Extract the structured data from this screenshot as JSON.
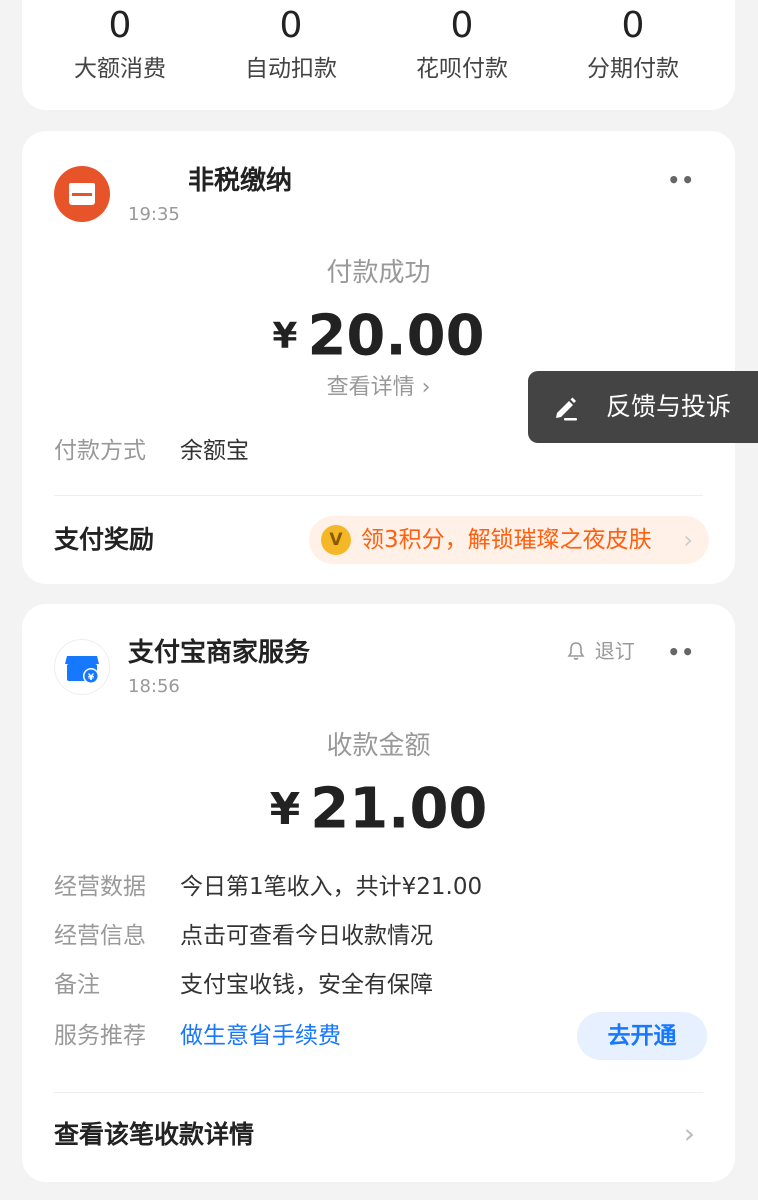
{
  "stats": [
    {
      "value": "0",
      "label": "大额消费"
    },
    {
      "value": "0",
      "label": "自动扣款"
    },
    {
      "value": "0",
      "label": "花呗付款"
    },
    {
      "value": "0",
      "label": "分期付款"
    }
  ],
  "payment_card": {
    "merchant": "非税缴纳",
    "time": "19:35",
    "more": "••",
    "status": "付款成功",
    "currency": "¥",
    "amount": "20.00",
    "detail_link": "查看详情 ›",
    "method_label": "付款方式",
    "method_value": "余额宝",
    "reward_label": "支付奖励",
    "reward_text": "领3积分，解锁璀璨之夜皮肤",
    "reward_coin": "V",
    "reward_arrow": "›"
  },
  "merchant_card": {
    "merchant": "支付宝商家服务",
    "time": "18:56",
    "unsubscribe": "退订",
    "more": "••",
    "status": "收款金额",
    "currency": "¥",
    "amount": "21.00",
    "rows": [
      {
        "label": "经营数据",
        "value": "今日第1笔收入，共计¥21.00"
      },
      {
        "label": "经营信息",
        "value": "点击可查看今日收款情况"
      },
      {
        "label": "备注",
        "value": "支付宝收钱，安全有保障"
      }
    ],
    "service_label": "服务推荐",
    "service_link": "做生意省手续费",
    "service_button": "去开通",
    "footer_link": "查看该笔收款详情",
    "footer_arrow": "›"
  },
  "feedback": {
    "label": "反馈与投诉"
  },
  "colors": {
    "accent_blue": "#1677ff",
    "reward_orange": "#ff6010",
    "avatar_orange": "#e8542a"
  }
}
